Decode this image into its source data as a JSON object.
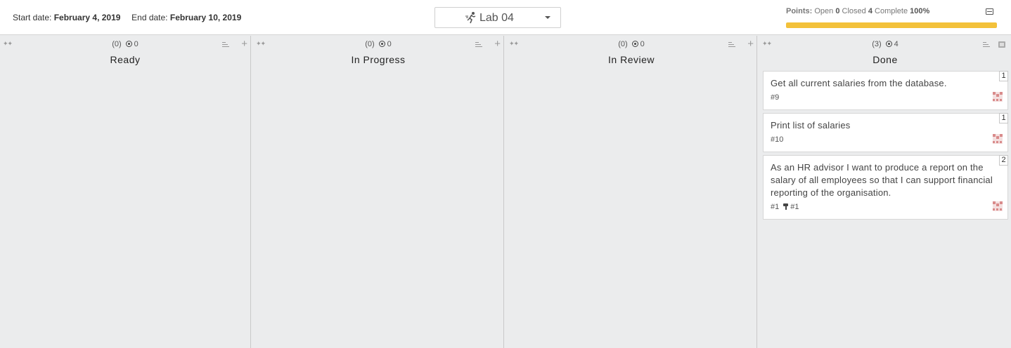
{
  "header": {
    "start_label": "Start date:",
    "start_value": "February 4, 2019",
    "end_label": "End date:",
    "end_value": "February 10, 2019",
    "sprint": "Lab 04",
    "points_label": "Points:",
    "open_label": "Open",
    "open_value": "0",
    "closed_label": "Closed",
    "closed_value": "4",
    "complete_label": "Complete",
    "complete_value": "100%",
    "progress_fraction": 1.0,
    "progress_color": "#f3c13a"
  },
  "columns": [
    {
      "count": "(0)",
      "points": "0",
      "title": "Ready"
    },
    {
      "count": "(0)",
      "points": "0",
      "title": "In Progress"
    },
    {
      "count": "(0)",
      "points": "0",
      "title": "In Review"
    },
    {
      "count": "(3)",
      "points": "4",
      "title": "Done"
    }
  ],
  "cards": [
    {
      "title": "Get all current salaries from the database.",
      "ref": "#9",
      "estimate": "1"
    },
    {
      "title": "Print list of salaries",
      "ref": "#10",
      "estimate": "1"
    },
    {
      "title": "As an HR advisor I want to produce a report on the salary of all employees so that I can support financial reporting of the organisation.",
      "ref": "#1",
      "pr_ref": "#1",
      "estimate": "2"
    }
  ],
  "icons": {
    "drag": "drag-handle-icon",
    "points": "target-icon",
    "sort": "sort-icon",
    "add": "plus-icon",
    "archive": "archive-icon",
    "sprint": "runner-icon",
    "collapse": "collapse-icon"
  }
}
